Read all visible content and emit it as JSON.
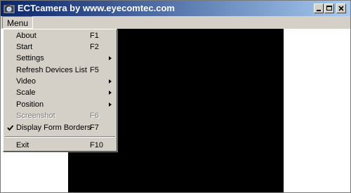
{
  "window": {
    "title": "ECTcamera by www.eyecomtec.com"
  },
  "menubar": {
    "menu_label": "Menu"
  },
  "menu": {
    "items": [
      {
        "label": "About",
        "shortcut": "F1"
      },
      {
        "label": "Start",
        "shortcut": "F2"
      },
      {
        "label": "Settings",
        "shortcut": ""
      },
      {
        "label": "Refresh Devices List",
        "shortcut": "F5"
      },
      {
        "label": "Video",
        "shortcut": ""
      },
      {
        "label": "Scale",
        "shortcut": ""
      },
      {
        "label": "Position",
        "shortcut": ""
      },
      {
        "label": "Screenshot",
        "shortcut": "F6",
        "disabled": true
      },
      {
        "label": "Display Form Borders",
        "shortcut": "F7",
        "checked": true
      },
      {
        "label": "Exit",
        "shortcut": "F10"
      }
    ]
  },
  "icons": {
    "app": "camera-icon",
    "minimize": "minimize-icon",
    "maximize": "maximize-icon",
    "close": "close-icon",
    "submenu": "submenu-arrow-icon",
    "check": "checkmark-icon"
  },
  "colors": {
    "titlebar_start": "#0a246a",
    "titlebar_end": "#a6caf0",
    "menu_bg": "#d4d0c8",
    "video_bg": "#000000"
  }
}
